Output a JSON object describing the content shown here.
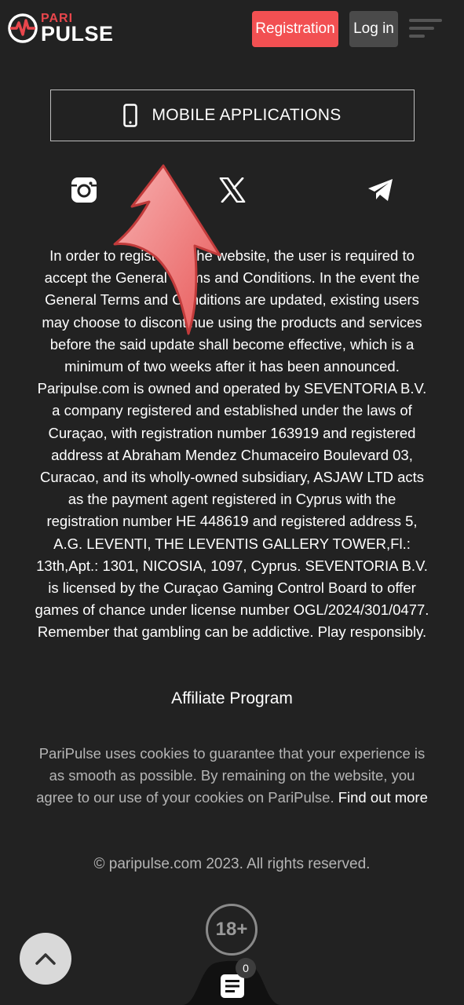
{
  "header": {
    "logo_top": "PARI",
    "logo_bottom": "PULSE",
    "registration_label": "Registration",
    "login_label": "Log in"
  },
  "mobile_apps": {
    "label": "MOBILE APPLICATIONS"
  },
  "socials": [
    "instagram-icon",
    "x-icon",
    "telegram-icon"
  ],
  "legal_text": "In order to register on the website, the user is required to accept the General Terms and Conditions. In the event the General Terms and Conditions are updated, existing users may choose to discontinue using the products and services before the said update shall become effective, which is a minimum of two weeks after it has been announced. Paripulse.com is owned and operated by SEVENTORIA B.V. a company registered and established under the laws of Curaçao, with registration number 163919 and registered address at Abraham Mendez Chumaceiro Boulevard 03, Curacao, and its wholly-owned subsidiary, ASJAW LTD acts as the payment agent registered in Cyprus with the registration number HE 448619 and registered address 5, A.G. LEVENTI, THE LEVENTIS GALLERY TOWER,Fl.: 13th,Apt.: 1301, NICOSIA, 1097, Cyprus. SEVENTORIA B.V. is licensed by the Curaçao Gaming Control Board to offer games of chance under license number OGL/2024/301/0477. Remember that gambling can be addictive. Play responsibly.",
  "affiliate_label": "Affiliate Program",
  "cookies": {
    "text": "PariPulse uses cookies to guarantee that your experience is as smooth as possible. By remaining on the website, you agree to our use of your cookies on PariPulse. ",
    "link": "Find out more"
  },
  "copyright": "© paripulse.com 2023. All rights reserved.",
  "age_badge": "18+",
  "betslip": {
    "count": "0"
  },
  "colors": {
    "brand_red": "#f25052",
    "background": "#222222"
  }
}
